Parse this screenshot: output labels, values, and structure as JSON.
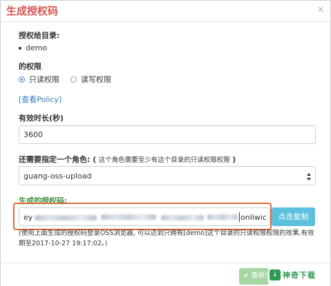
{
  "dialog": {
    "title": "生成授权码",
    "close_glyph": "×"
  },
  "dir_section": {
    "label": "授权给目录:",
    "items": [
      "demo"
    ]
  },
  "permission": {
    "label": "的权限",
    "options": [
      {
        "label": "只读权限",
        "checked": true
      },
      {
        "label": "读写权限",
        "checked": false
      }
    ],
    "policy_link": "[查看Policy]"
  },
  "duration": {
    "label": "有效时长(秒)",
    "value": "3600"
  },
  "role": {
    "label": "还需要指定一个角色: (",
    "note": "这个角色需要至少有这个目录的只读权限权限",
    "label_end": ")",
    "selected": "guang-oss-upload"
  },
  "auth_code": {
    "label": "生成的授权码:",
    "value_prefix": "ey",
    "value_suffix": "onliwic",
    "copy_button": "点击复制",
    "hint_line1": "(使用上面生成的授权码登录OSS浏览器, 可以达到只拥有[demo]这个目录的只读权限权限的效果,有效",
    "hint_line2": "期至2017-10-27 19:17:02。)"
  },
  "footer": {
    "ok_button": "✔ 重新生成",
    "watermark_text": "神奇下载",
    "watermark_icon": "download-icon"
  },
  "colors": {
    "title": "#d9534f",
    "accent": "#337ab7",
    "copy_button": "#5bc0de",
    "highlight_frame": "#e0673a",
    "success": "#5cb85c"
  }
}
